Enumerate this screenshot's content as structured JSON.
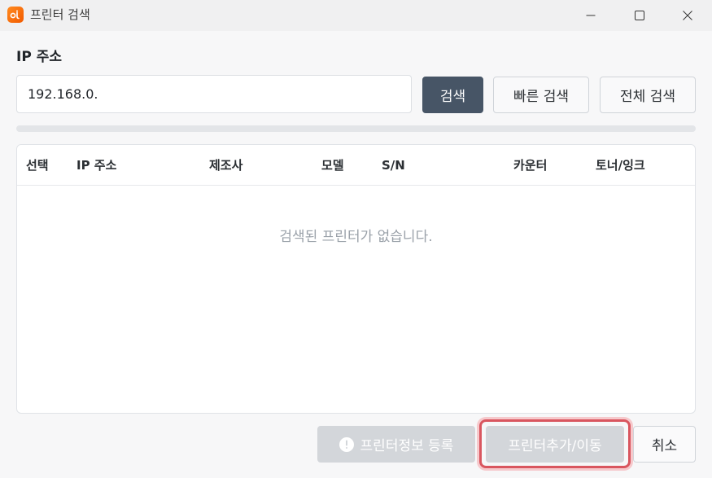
{
  "window": {
    "title": "프린터 검색",
    "app_icon": "printer-app-logo"
  },
  "ip_section": {
    "label": "IP 주소",
    "input_value": "192.168.0."
  },
  "buttons": {
    "search": "검색",
    "fast_search": "빠른 검색",
    "full_search": "전체 검색",
    "register_info": "프린터정보 등록",
    "add_move": "프린터추가/이동",
    "cancel": "취소"
  },
  "progress": {
    "value_percent": 0
  },
  "table": {
    "columns": [
      "선택",
      "IP 주소",
      "제조사",
      "모델",
      "S/N",
      "카운터",
      "토너/잉크"
    ],
    "rows": [],
    "empty_message": "검색된 프린터가 없습니다."
  },
  "colors": {
    "accent": "#475566",
    "app_icon": "#f25a00",
    "focus_ring": "#d9565f",
    "disabled_button": "#d3d6da"
  },
  "icons": {
    "minimize": "minimize-icon",
    "maximize": "maximize-icon",
    "close": "close-icon",
    "warning": "exclamation-circle-icon"
  }
}
